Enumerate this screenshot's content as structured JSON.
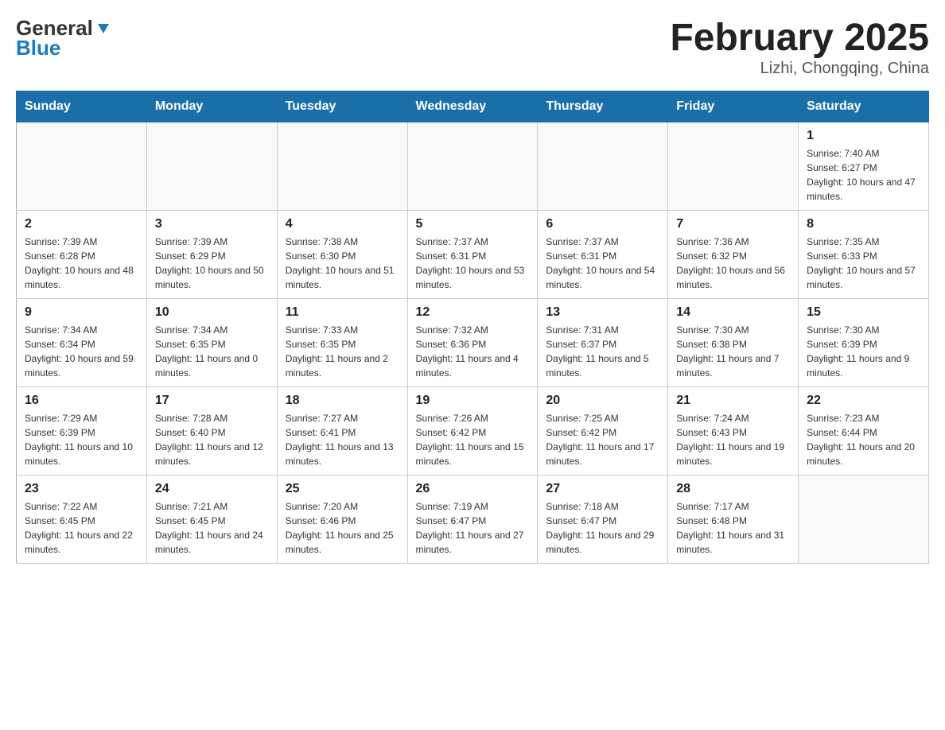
{
  "logo": {
    "general": "General",
    "blue": "Blue",
    "arrow": "▼"
  },
  "header": {
    "title": "February 2025",
    "location": "Lizhi, Chongqing, China"
  },
  "days_of_week": [
    "Sunday",
    "Monday",
    "Tuesday",
    "Wednesday",
    "Thursday",
    "Friday",
    "Saturday"
  ],
  "weeks": [
    [
      {
        "day": "",
        "info": ""
      },
      {
        "day": "",
        "info": ""
      },
      {
        "day": "",
        "info": ""
      },
      {
        "day": "",
        "info": ""
      },
      {
        "day": "",
        "info": ""
      },
      {
        "day": "",
        "info": ""
      },
      {
        "day": "1",
        "info": "Sunrise: 7:40 AM\nSunset: 6:27 PM\nDaylight: 10 hours and 47 minutes."
      }
    ],
    [
      {
        "day": "2",
        "info": "Sunrise: 7:39 AM\nSunset: 6:28 PM\nDaylight: 10 hours and 48 minutes."
      },
      {
        "day": "3",
        "info": "Sunrise: 7:39 AM\nSunset: 6:29 PM\nDaylight: 10 hours and 50 minutes."
      },
      {
        "day": "4",
        "info": "Sunrise: 7:38 AM\nSunset: 6:30 PM\nDaylight: 10 hours and 51 minutes."
      },
      {
        "day": "5",
        "info": "Sunrise: 7:37 AM\nSunset: 6:31 PM\nDaylight: 10 hours and 53 minutes."
      },
      {
        "day": "6",
        "info": "Sunrise: 7:37 AM\nSunset: 6:31 PM\nDaylight: 10 hours and 54 minutes."
      },
      {
        "day": "7",
        "info": "Sunrise: 7:36 AM\nSunset: 6:32 PM\nDaylight: 10 hours and 56 minutes."
      },
      {
        "day": "8",
        "info": "Sunrise: 7:35 AM\nSunset: 6:33 PM\nDaylight: 10 hours and 57 minutes."
      }
    ],
    [
      {
        "day": "9",
        "info": "Sunrise: 7:34 AM\nSunset: 6:34 PM\nDaylight: 10 hours and 59 minutes."
      },
      {
        "day": "10",
        "info": "Sunrise: 7:34 AM\nSunset: 6:35 PM\nDaylight: 11 hours and 0 minutes."
      },
      {
        "day": "11",
        "info": "Sunrise: 7:33 AM\nSunset: 6:35 PM\nDaylight: 11 hours and 2 minutes."
      },
      {
        "day": "12",
        "info": "Sunrise: 7:32 AM\nSunset: 6:36 PM\nDaylight: 11 hours and 4 minutes."
      },
      {
        "day": "13",
        "info": "Sunrise: 7:31 AM\nSunset: 6:37 PM\nDaylight: 11 hours and 5 minutes."
      },
      {
        "day": "14",
        "info": "Sunrise: 7:30 AM\nSunset: 6:38 PM\nDaylight: 11 hours and 7 minutes."
      },
      {
        "day": "15",
        "info": "Sunrise: 7:30 AM\nSunset: 6:39 PM\nDaylight: 11 hours and 9 minutes."
      }
    ],
    [
      {
        "day": "16",
        "info": "Sunrise: 7:29 AM\nSunset: 6:39 PM\nDaylight: 11 hours and 10 minutes."
      },
      {
        "day": "17",
        "info": "Sunrise: 7:28 AM\nSunset: 6:40 PM\nDaylight: 11 hours and 12 minutes."
      },
      {
        "day": "18",
        "info": "Sunrise: 7:27 AM\nSunset: 6:41 PM\nDaylight: 11 hours and 13 minutes."
      },
      {
        "day": "19",
        "info": "Sunrise: 7:26 AM\nSunset: 6:42 PM\nDaylight: 11 hours and 15 minutes."
      },
      {
        "day": "20",
        "info": "Sunrise: 7:25 AM\nSunset: 6:42 PM\nDaylight: 11 hours and 17 minutes."
      },
      {
        "day": "21",
        "info": "Sunrise: 7:24 AM\nSunset: 6:43 PM\nDaylight: 11 hours and 19 minutes."
      },
      {
        "day": "22",
        "info": "Sunrise: 7:23 AM\nSunset: 6:44 PM\nDaylight: 11 hours and 20 minutes."
      }
    ],
    [
      {
        "day": "23",
        "info": "Sunrise: 7:22 AM\nSunset: 6:45 PM\nDaylight: 11 hours and 22 minutes."
      },
      {
        "day": "24",
        "info": "Sunrise: 7:21 AM\nSunset: 6:45 PM\nDaylight: 11 hours and 24 minutes."
      },
      {
        "day": "25",
        "info": "Sunrise: 7:20 AM\nSunset: 6:46 PM\nDaylight: 11 hours and 25 minutes."
      },
      {
        "day": "26",
        "info": "Sunrise: 7:19 AM\nSunset: 6:47 PM\nDaylight: 11 hours and 27 minutes."
      },
      {
        "day": "27",
        "info": "Sunrise: 7:18 AM\nSunset: 6:47 PM\nDaylight: 11 hours and 29 minutes."
      },
      {
        "day": "28",
        "info": "Sunrise: 7:17 AM\nSunset: 6:48 PM\nDaylight: 11 hours and 31 minutes."
      },
      {
        "day": "",
        "info": ""
      }
    ]
  ]
}
